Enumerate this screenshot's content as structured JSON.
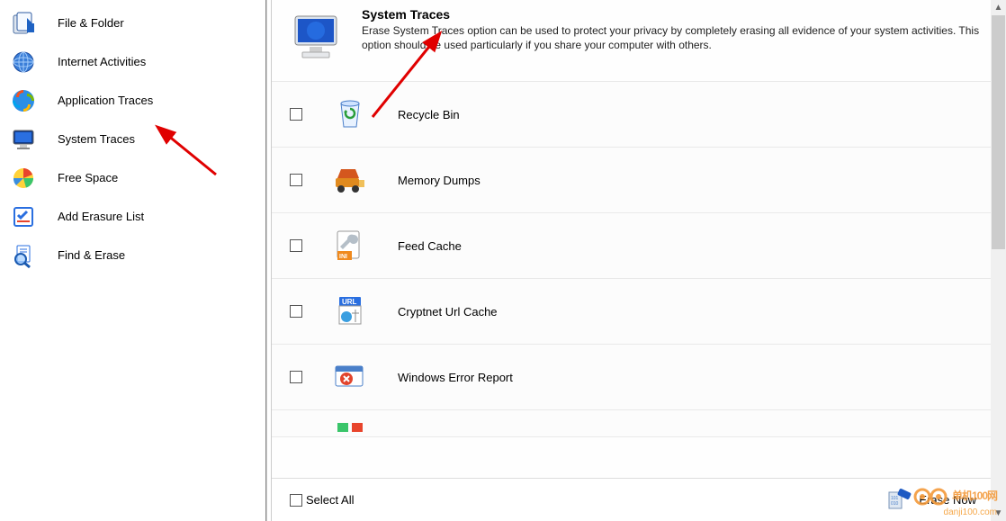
{
  "sidebar": {
    "items": [
      {
        "label": "File & Folder",
        "icon": "file-folder-icon"
      },
      {
        "label": "Internet Activities",
        "icon": "globe-icon"
      },
      {
        "label": "Application Traces",
        "icon": "windows-icon"
      },
      {
        "label": "System Traces",
        "icon": "monitor-icon"
      },
      {
        "label": "Free Space",
        "icon": "pie-chart-icon"
      },
      {
        "label": "Add Erasure List",
        "icon": "checklist-icon"
      },
      {
        "label": "Find & Erase",
        "icon": "magnifier-doc-icon"
      }
    ]
  },
  "header": {
    "title": "System Traces",
    "description": "Erase System Traces option can be used to protect your privacy by completely erasing all evidence of your system activities. This option should be used particularly if you share your computer with others."
  },
  "traces": [
    {
      "label": "Recycle Bin",
      "icon": "recycle-bin-icon"
    },
    {
      "label": "Memory Dumps",
      "icon": "dump-truck-icon"
    },
    {
      "label": "Feed Cache",
      "icon": "feed-wrench-icon"
    },
    {
      "label": "Cryptnet Url Cache",
      "icon": "url-globe-icon"
    },
    {
      "label": "Windows Error Report",
      "icon": "error-window-icon"
    }
  ],
  "footer": {
    "select_all_label": "Select All",
    "erase_now_label": "Erase Now"
  },
  "watermark": {
    "brand": "单机100网",
    "url": "danji100.com"
  }
}
